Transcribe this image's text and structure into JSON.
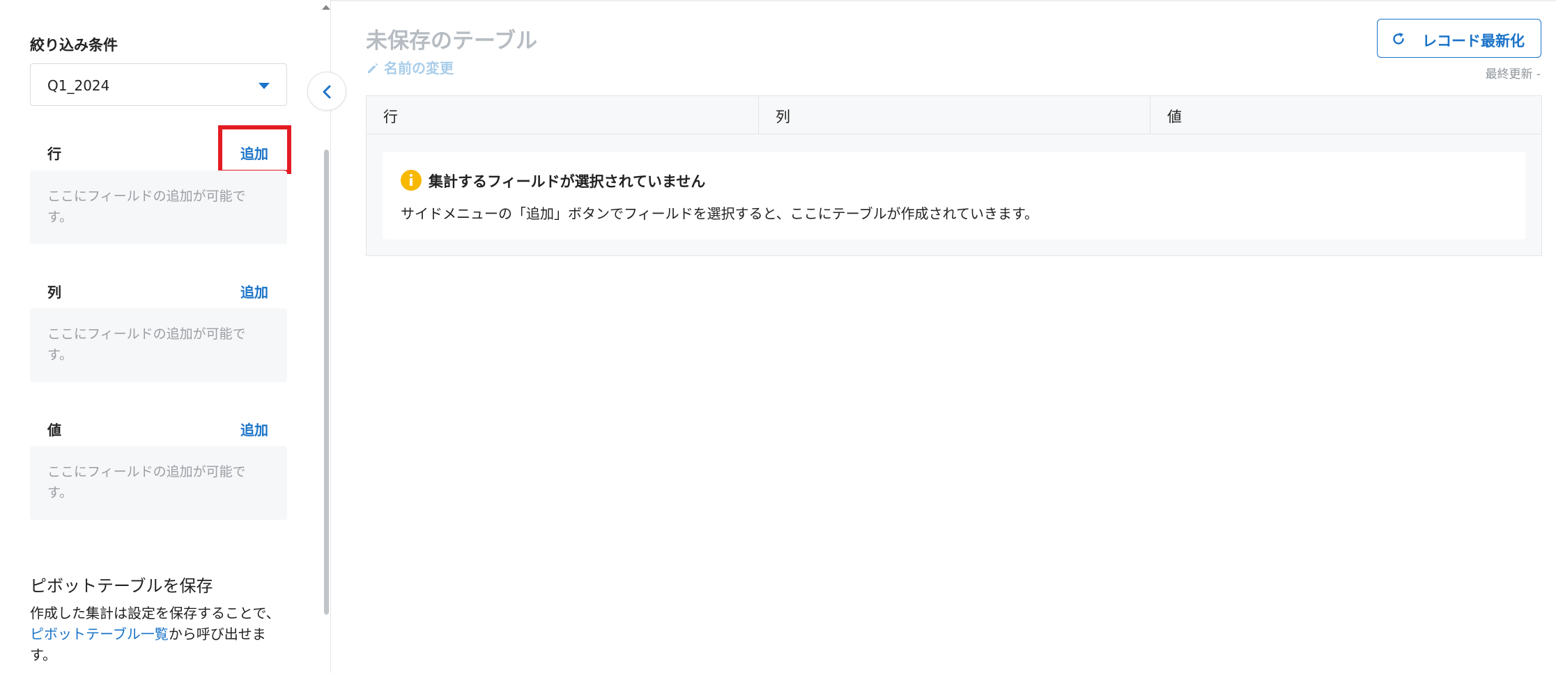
{
  "sidebar": {
    "filter_label": "絞り込み条件",
    "filter_value": "Q1_2024",
    "sections": [
      {
        "title": "行",
        "add_label": "追加",
        "placeholder": "ここにフィールドの追加が可能です。"
      },
      {
        "title": "列",
        "add_label": "追加",
        "placeholder": "ここにフィールドの追加が可能です。"
      },
      {
        "title": "値",
        "add_label": "追加",
        "placeholder": "ここにフィールドの追加が可能です。"
      }
    ],
    "save": {
      "title": "ピボットテーブルを保存",
      "desc_before": "作成した集計は設定を保存することで、",
      "desc_link": "ピボットテーブル一覧",
      "desc_after": "から呼び出せます。"
    }
  },
  "main": {
    "title": "未保存のテーブル",
    "rename_label": "名前の変更",
    "refresh_label": "レコード最新化",
    "last_updated": "最終更新 -",
    "table_headers": [
      "行",
      "列",
      "値"
    ],
    "empty_title": "集計するフィールドが選択されていません",
    "empty_body": "サイドメニューの「追加」ボタンでフィールドを選択すると、ここにテーブルが作成されていきます。"
  },
  "colors": {
    "accent": "#1a73c8",
    "highlight": "#e31b23",
    "warning": "#f7b800"
  },
  "icons": [
    "chevron-down-icon",
    "chevron-left-icon",
    "pencil-icon",
    "refresh-icon",
    "info-icon"
  ]
}
